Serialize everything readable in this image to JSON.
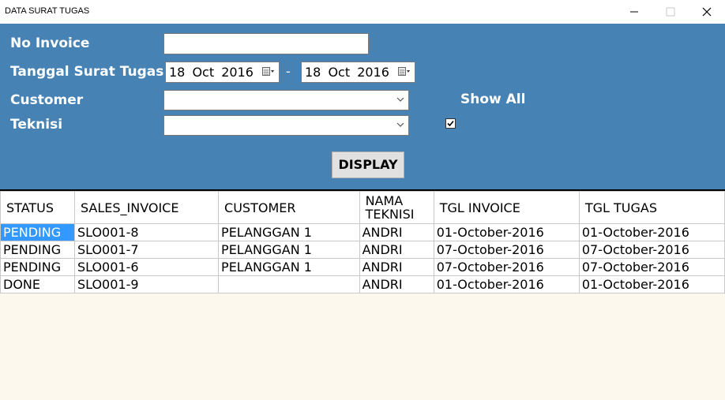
{
  "window": {
    "title": "DATA SURAT TUGAS",
    "minimize": "—",
    "maximize": "☐",
    "close": "✕"
  },
  "form": {
    "no_invoice_label": "No Invoice",
    "no_invoice_value": "",
    "tanggal_label": "Tanggal Surat Tugas",
    "date_from": "18 Oct 2016",
    "date_separator": "-",
    "date_to": "18 Oct 2016",
    "customer_label": "Customer",
    "customer_value": "",
    "teknisi_label": "Teknisi",
    "teknisi_value": "",
    "show_all_label": "Show All",
    "show_all_checked": true,
    "display_button": "DISPLAY"
  },
  "table": {
    "columns": [
      "STATUS",
      "SALES_INVOICE",
      "CUSTOMER",
      "NAMA TEKNISI",
      "TGL INVOICE",
      "TGL TUGAS"
    ],
    "rows": [
      [
        "PENDING",
        "SLO001-8",
        "PELANGGAN 1",
        "ANDRI",
        "01-October-2016",
        "01-October-2016"
      ],
      [
        "PENDING",
        "SLO001-7",
        "PELANGGAN 1",
        "ANDRI",
        "07-October-2016",
        "07-October-2016"
      ],
      [
        "PENDING",
        "SLO001-6",
        "PELANGGAN 1",
        "ANDRI",
        "07-October-2016",
        "07-October-2016"
      ],
      [
        "DONE",
        "SLO001-9",
        "",
        "ANDRI",
        "01-October-2016",
        "01-October-2016"
      ]
    ]
  },
  "colors": {
    "panel": "#4682b4",
    "selection": "#3399ff",
    "empty_area": "#fdf8ee"
  }
}
